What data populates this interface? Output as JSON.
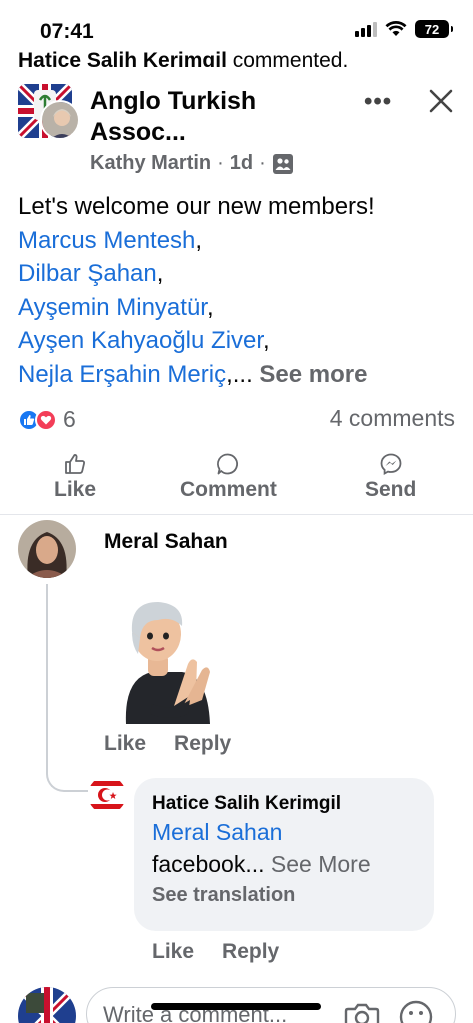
{
  "status": {
    "time": "07:41",
    "battery": "72"
  },
  "clipped_header": {
    "name": "Hatice Salih Kerimgil",
    "action": "commented."
  },
  "post": {
    "group_name": "Anglo Turkish Assoc...",
    "author": "Kathy Martin",
    "time": "1d",
    "intro": "Let's welcome our new members!",
    "tags": [
      "Marcus Mentesh",
      "Dilbar Şahan",
      "Ayşemin Minyatür",
      "Ayşen Kahyaoğlu Ziver",
      "Nejla Erşahin Meriç"
    ],
    "separator": ",",
    "ellipsis": ",... ",
    "see_more": "See more",
    "reaction_count": "6",
    "comment_count": "4 comments"
  },
  "actions": {
    "like": "Like",
    "comment": "Comment",
    "send": "Send"
  },
  "comments": [
    {
      "name": "Meral Sahan",
      "like": "Like",
      "reply": "Reply"
    },
    {
      "name": "Hatice Salih Kerimgil",
      "tag": "Meral Sahan",
      "text": "facebook...",
      "see_more": "See More",
      "translate": "See translation",
      "like": "Like",
      "reply": "Reply"
    }
  ],
  "composer": {
    "placeholder": "Write a comment..."
  },
  "colors": {
    "link": "#1a6ed8",
    "secondary": "#65676b",
    "like": "#1877f2",
    "love": "#f33e58"
  },
  "icons": [
    "signal-icon",
    "wifi-icon",
    "battery-icon",
    "group-members-icon",
    "more-icon",
    "close-icon",
    "like-reaction-icon",
    "love-reaction-icon",
    "like-outline-icon",
    "comment-outline-icon",
    "messenger-icon",
    "camera-icon",
    "emoji-icon"
  ]
}
